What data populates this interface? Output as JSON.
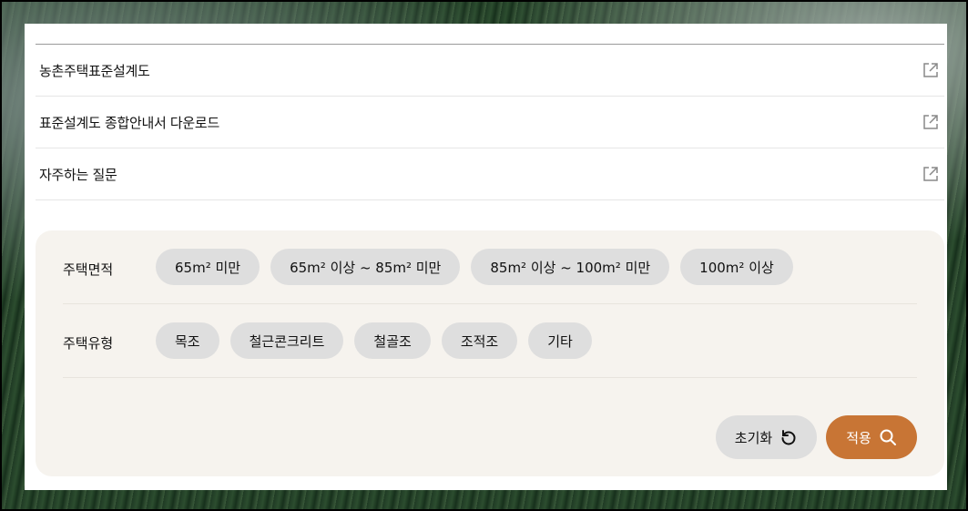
{
  "links": [
    {
      "label": "농촌주택표준설계도",
      "icon": "external-link-icon"
    },
    {
      "label": "표준설계도 종합안내서 다운로드",
      "icon": "external-link-icon"
    },
    {
      "label": "자주하는 질문",
      "icon": "external-link-icon"
    }
  ],
  "filters": {
    "area": {
      "label": "주택면적",
      "options": [
        "65m² 미만",
        "65m² 이상 ~ 85m² 미만",
        "85m² 이상 ~ 100m² 미만",
        "100m² 이상"
      ]
    },
    "type": {
      "label": "주택유형",
      "options": [
        "목조",
        "철근콘크리트",
        "철골조",
        "조적조",
        "기타"
      ]
    }
  },
  "actions": {
    "reset_label": "초기화",
    "reset_icon": "refresh-icon",
    "apply_label": "적용",
    "apply_icon": "search-icon"
  },
  "colors": {
    "accent": "#c87535",
    "chip_bg": "#dedede",
    "filter_bg": "#f6f3ee"
  }
}
